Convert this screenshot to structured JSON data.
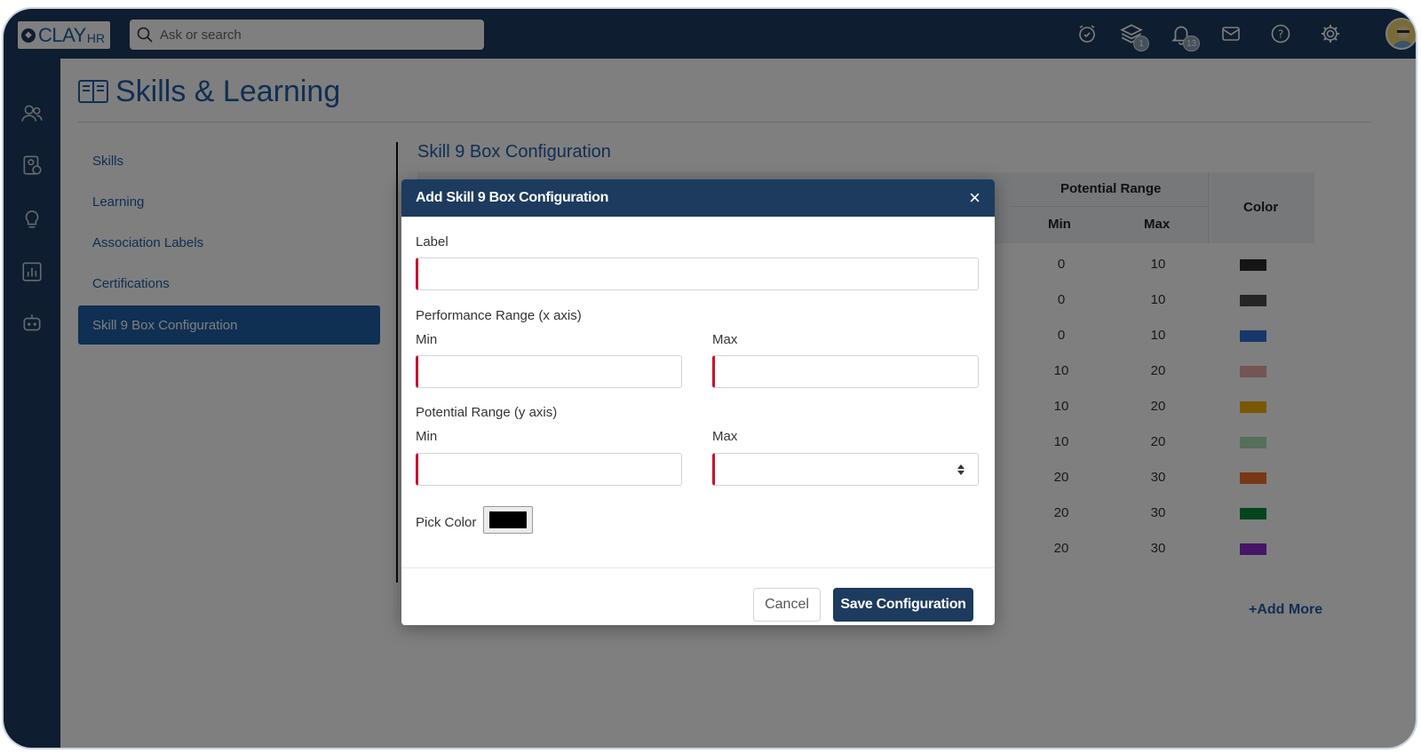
{
  "topbar": {
    "logo": {
      "text": "CLAY",
      "sub": "HR"
    },
    "search_placeholder": "Ask or search",
    "icons": [
      {
        "name": "alarm-clock-icon",
        "badge": ""
      },
      {
        "name": "layers-icon",
        "badge": "1"
      },
      {
        "name": "bell-icon",
        "badge": "13"
      },
      {
        "name": "mail-icon",
        "badge": ""
      },
      {
        "name": "help-icon",
        "badge": ""
      },
      {
        "name": "gear-icon",
        "badge": ""
      }
    ]
  },
  "rail": [
    "people-icon",
    "id-badge-icon",
    "lightbulb-icon",
    "chart-icon",
    "robot-icon"
  ],
  "page": {
    "title": "Skills & Learning",
    "nav": [
      "Skills",
      "Learning",
      "Association Labels",
      "Certifications",
      "Skill 9 Box Configuration"
    ],
    "active_nav": "Skill 9 Box Configuration"
  },
  "config": {
    "section_title": "Skill 9 Box Configuration",
    "headers": {
      "potential_range": "Potential Range",
      "min": "Min",
      "max": "Max",
      "color": "Color"
    },
    "rows": [
      {
        "min": "0",
        "max": "10",
        "color": "#2b2b2b"
      },
      {
        "min": "0",
        "max": "10",
        "color": "#4a4a4a"
      },
      {
        "min": "0",
        "max": "10",
        "color": "#2f6fd6"
      },
      {
        "min": "10",
        "max": "20",
        "color": "#e8a8a8"
      },
      {
        "min": "10",
        "max": "20",
        "color": "#f0b000"
      },
      {
        "min": "10",
        "max": "20",
        "color": "#a8e0b0"
      },
      {
        "min": "20",
        "max": "30",
        "color": "#f0702a"
      },
      {
        "min": "20",
        "max": "30",
        "color": "#0a8a3a"
      },
      {
        "min": "20",
        "max": "30",
        "color": "#8a2ad0"
      }
    ],
    "add_more": "+Add More"
  },
  "modal": {
    "title": "Add Skill 9 Box Configuration",
    "close": "×",
    "label": "Label",
    "performance_range": "Performance Range (x axis)",
    "potential_range": "Potential Range (y axis)",
    "min": "Min",
    "max": "Max",
    "pick_color": "Pick Color",
    "picked_color": "#000000",
    "cancel": "Cancel",
    "save": "Save Configuration"
  }
}
